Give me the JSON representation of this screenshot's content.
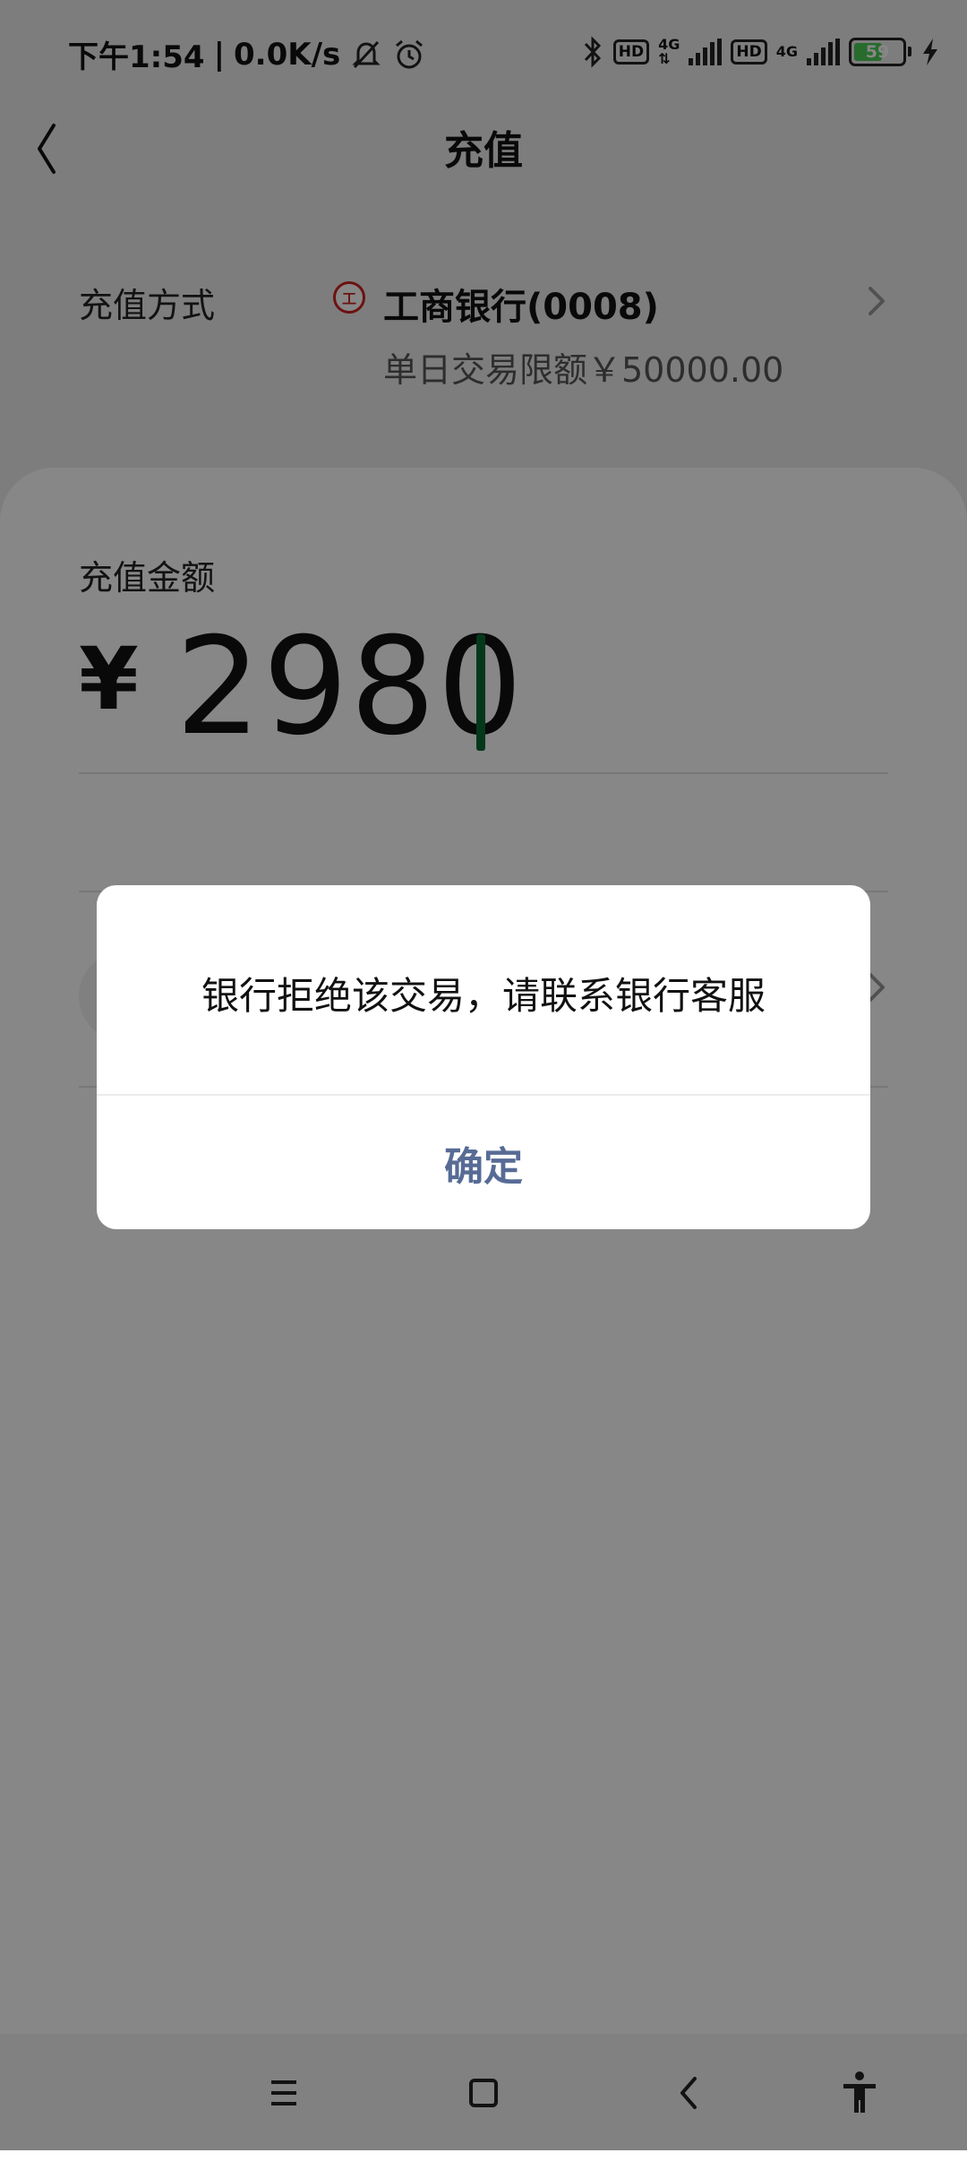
{
  "status_bar": {
    "time": "下午1:54",
    "speed": "0.0K/s",
    "hd_label": "HD",
    "network_label": "4G",
    "battery": "59",
    "battery_level": 0.59,
    "icons": [
      "mute-bell-icon",
      "alarm-icon",
      "bluetooth-icon",
      "signal-icon",
      "battery-icon",
      "charging-icon"
    ]
  },
  "header": {
    "title": "充值"
  },
  "method": {
    "label": "充值方式",
    "bank_logo_text": "工",
    "bank_name": "工商银行(0008)",
    "limit": "单日交易限额￥50000.00"
  },
  "amount": {
    "label": "充值金额",
    "currency": "¥",
    "value": "2980"
  },
  "dialog": {
    "message": "银行拒绝该交易，请联系银行客服",
    "confirm": "确定"
  },
  "colors": {
    "dialog_button": "#576b95",
    "caret": "#0a6b32",
    "battery_fill": "#4ccd55"
  }
}
